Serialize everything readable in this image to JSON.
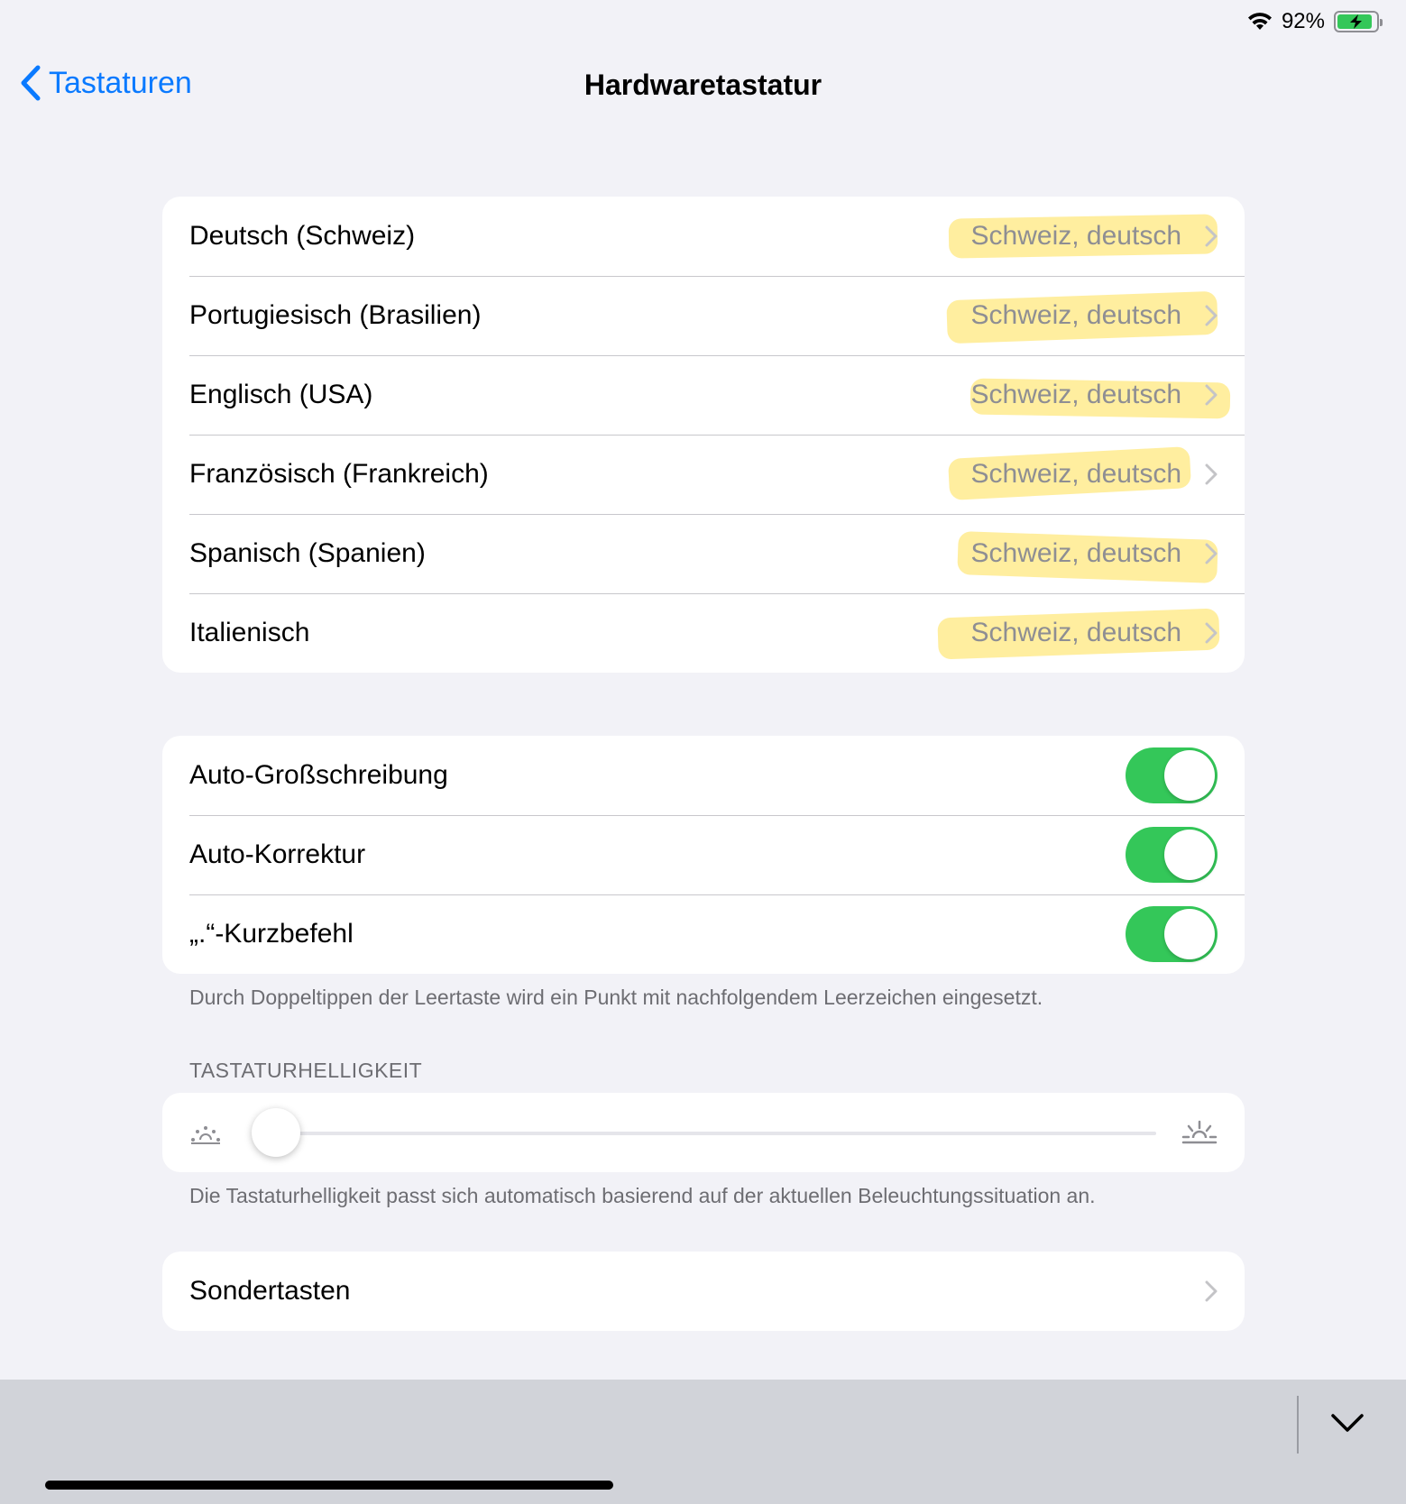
{
  "status_bar": {
    "battery_percent": "92%",
    "battery_level": 0.92,
    "wifi_icon": "wifi-icon",
    "charging": true
  },
  "nav": {
    "back_label": "Tastaturen",
    "title": "Hardwaretastatur"
  },
  "languages": [
    {
      "label": "Deutsch (Schweiz)",
      "value": "Schweiz, deutsch"
    },
    {
      "label": "Portugiesisch (Brasilien)",
      "value": "Schweiz, deutsch"
    },
    {
      "label": "Englisch (USA)",
      "value": "Schweiz, deutsch"
    },
    {
      "label": "Französisch (Frankreich)",
      "value": "Schweiz, deutsch"
    },
    {
      "label": "Spanisch (Spanien)",
      "value": "Schweiz, deutsch"
    },
    {
      "label": "Italienisch",
      "value": "Schweiz, deutsch"
    }
  ],
  "toggles": [
    {
      "label": "Auto-Großschreibung",
      "on": true
    },
    {
      "label": "Auto-Korrektur",
      "on": true
    },
    {
      "label": "„.“-Kurzbefehl",
      "on": true
    }
  ],
  "toggles_footer": "Durch Doppeltippen der Leertaste wird ein Punkt mit nachfolgendem Leerzeichen eingesetzt.",
  "brightness": {
    "header": "TASTATURHELLIGKEIT",
    "level": 0.0,
    "footer": "Die Tastaturhelligkeit passt sich automatisch basierend auf der aktuellen Beleuchtungssituation an."
  },
  "special_keys": {
    "label": "Sondertasten"
  },
  "colors": {
    "accent": "#0a7aff",
    "toggle_on": "#34c759",
    "highlight": "#ffe050",
    "background": "#f2f2f7"
  }
}
